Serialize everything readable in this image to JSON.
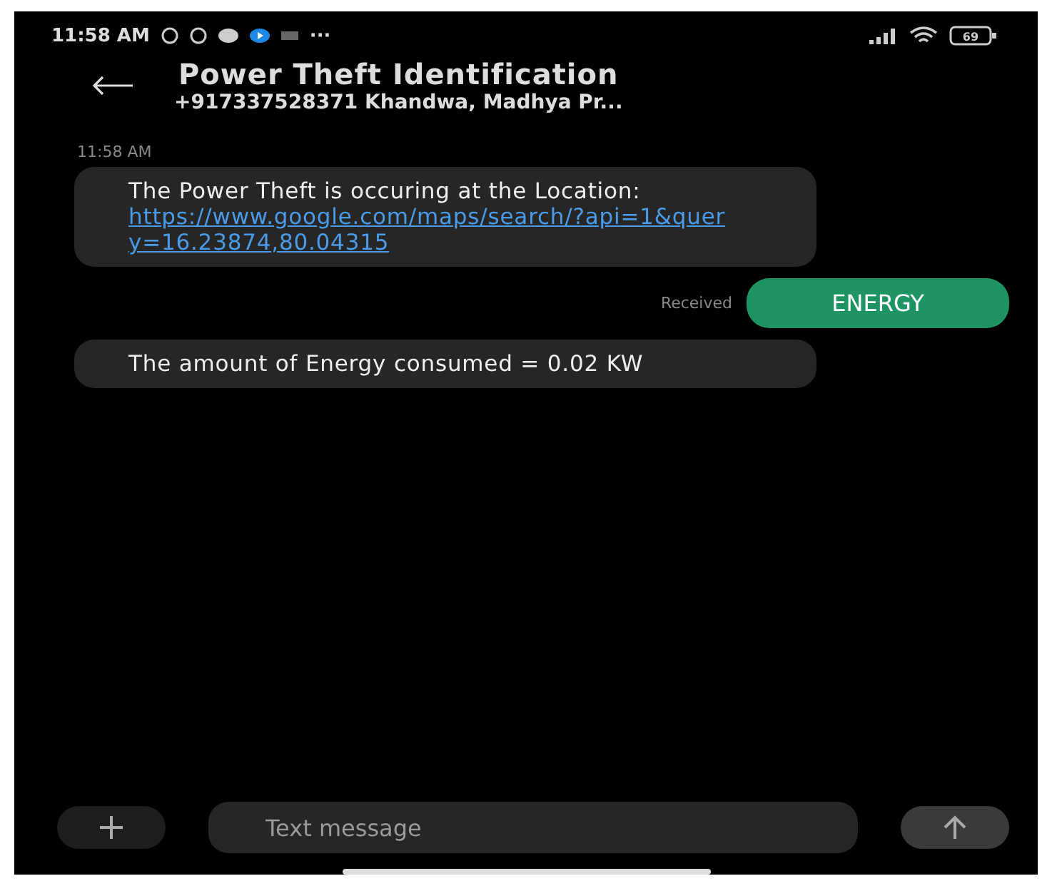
{
  "status_bar": {
    "time": "11:58 AM",
    "overflow": "···",
    "battery": "69"
  },
  "header": {
    "title": "Power Theft Identification",
    "subtitle": "+917337528371 Khandwa, Madhya Pr..."
  },
  "timestamp": "11:58 AM",
  "messages": [
    {
      "kind": "incoming",
      "text": "The Power Theft is occuring at the Location:",
      "link": "https://www.google.com/maps/search/?api=1&query=16.23874,80.04315"
    },
    {
      "kind": "outgoing",
      "text": "ENERGY",
      "status": "Received"
    },
    {
      "kind": "incoming",
      "text": "The amount of Energy consumed = 0.02 KW"
    }
  ],
  "composer": {
    "placeholder": "Text message"
  }
}
